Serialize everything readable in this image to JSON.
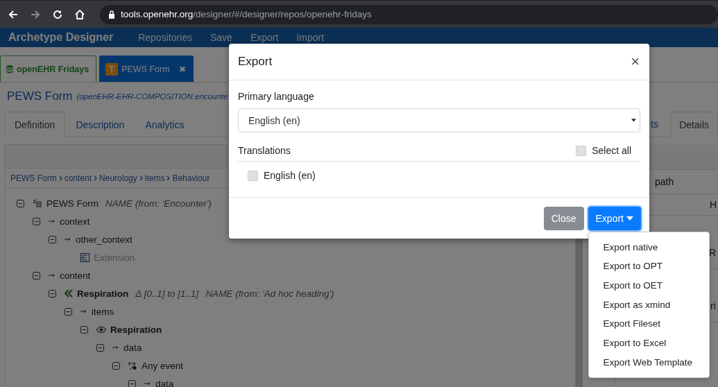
{
  "browser": {
    "url_host": "tools.openehr.org",
    "url_path": "/designer/#/designer/repos/openehr-fridays"
  },
  "navbar": {
    "brand": "Archetype Designer",
    "menu": [
      "Repositories",
      "Save",
      "Export",
      "Import"
    ]
  },
  "editor_tabs": [
    {
      "kind": "repository",
      "label": "openEHR Fridays",
      "selected": false
    },
    {
      "kind": "template",
      "icon_letter": "T",
      "label": "PEWS Form",
      "close": "✖",
      "selected": true
    }
  ],
  "document": {
    "title": "PEWS Form",
    "subtitle": "(openEHR-EHR-COMPOSITION.encounte"
  },
  "view_tabs": [
    {
      "label": "Definition",
      "selected": true
    },
    {
      "label": "Description",
      "selected": false
    },
    {
      "label": "Analytics",
      "selected": false
    }
  ],
  "breadcrumb": [
    "PEWS Form",
    "content",
    "Neurology",
    "items",
    "Behaviour"
  ],
  "tree": [
    {
      "kind": "composition",
      "label": "PEWS Form",
      "annotations": [
        "NAME (from: 'Encounter')"
      ],
      "expanded": true,
      "children": [
        {
          "kind": "attribute",
          "label": "context",
          "expanded": true,
          "children": [
            {
              "kind": "attribute",
              "label": "other_context",
              "expanded": true,
              "children": [
                {
                  "kind": "slot",
                  "label": "Extension"
                }
              ]
            }
          ]
        },
        {
          "kind": "attribute",
          "label": "content",
          "expanded": true,
          "children": [
            {
              "kind": "section",
              "label": "Respiration",
              "annotations": [
                "Δ [0..1] to [1..1]",
                "NAME (from: 'Ad hoc heading')"
              ],
              "expanded": true,
              "children": [
                {
                  "kind": "attribute",
                  "label": "items",
                  "expanded": true,
                  "children": [
                    {
                      "kind": "observation",
                      "label": "Respiration",
                      "expanded": true,
                      "children": [
                        {
                          "kind": "attribute",
                          "label": "data",
                          "expanded": true,
                          "children": [
                            {
                              "kind": "event",
                              "label": "Any event",
                              "expanded": true,
                              "children": [
                                {
                                  "kind": "attribute",
                                  "label": "data",
                                  "expanded": true
                                }
                              ]
                            }
                          ]
                        }
                      ]
                    }
                  ]
                }
              ]
            }
          ]
        }
      ]
    }
  ],
  "side_panel": {
    "tabs": [
      {
        "label": "ts",
        "selected": false
      },
      {
        "label": "Details",
        "selected": true
      }
    ],
    "rows": [
      "path",
      "H",
      "R",
      "ri"
    ]
  },
  "modal": {
    "title": "Export",
    "close": "×",
    "primary_language": {
      "label": "Primary language",
      "value": "English (en)"
    },
    "translations": {
      "label": "Translations",
      "select_all": {
        "label": "Select all",
        "checked": false
      },
      "items": [
        {
          "label": "English (en)",
          "checked": false
        }
      ]
    },
    "buttons": [
      {
        "kind": "secondary",
        "label": "Close",
        "caret": false
      },
      {
        "kind": "primary",
        "label": "Export",
        "caret": true
      }
    ],
    "menu": [
      "Export native",
      "Export to OPT",
      "Export to OET",
      "Export as xmind",
      "Export Fileset",
      "Export to Excel",
      "Export Web Template"
    ]
  }
}
